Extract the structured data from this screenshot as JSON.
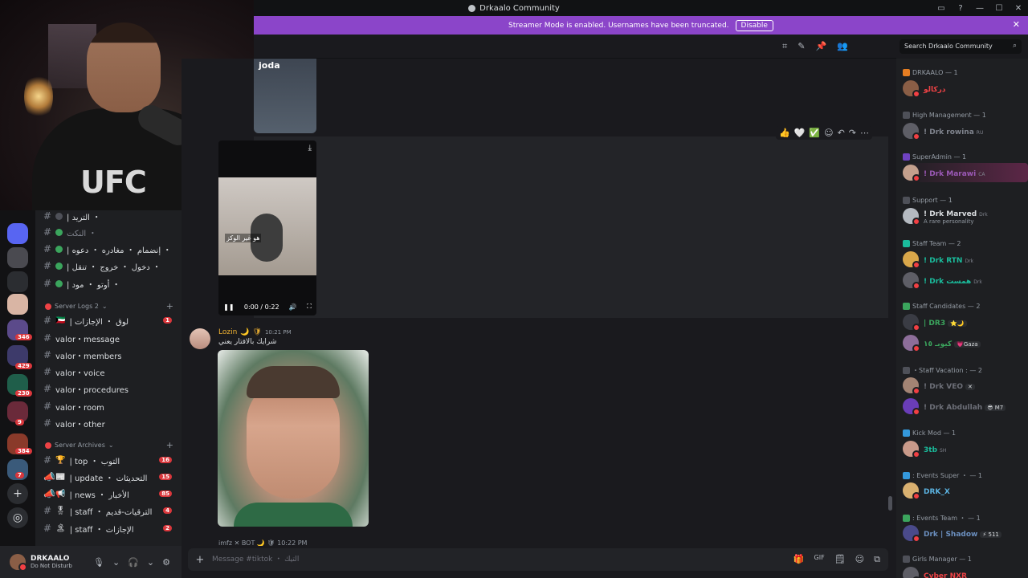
{
  "window": {
    "title": "Drkaalo Community",
    "controls": [
      "▭",
      "?",
      "—",
      "☐",
      "✕"
    ]
  },
  "streamer": {
    "message": "Streamer Mode is enabled. Usernames have been truncated.",
    "disable_label": "Disable",
    "close": "✕"
  },
  "search": {
    "placeholder": "Search Drkaalo Community",
    "icon": "⌕"
  },
  "header_icons": [
    "⌗",
    "✎",
    "📌",
    "👥"
  ],
  "webcam": {
    "shirt_text": "UFC"
  },
  "servers": [
    {
      "badge": ""
    },
    {
      "badge": ""
    },
    {
      "badge": ""
    },
    {
      "badge": ""
    },
    {
      "badge": "346"
    },
    {
      "badge": "429"
    },
    {
      "badge": "230"
    },
    {
      "badge": "9"
    },
    {
      "badge": "384"
    },
    {
      "badge": "7"
    }
  ],
  "server_actions": {
    "add": "+",
    "discover": "◎"
  },
  "channels_top": [
    {
      "name": "| التريد ・",
      "dot": "gray"
    },
    {
      "name": "النكت ・",
      "dot": "green",
      "muted": true
    },
    {
      "name": "| إنضمام ・ مغادره ・ دعوه ・",
      "dot": "green"
    },
    {
      "name": "| دخول ・ خروج ・ تنقل ・",
      "dot": "green"
    },
    {
      "name": "| أوتو ・ مود ・",
      "dot": "green"
    }
  ],
  "category_logs": {
    "label": "Server Logs 2",
    "plus": "+"
  },
  "channels_logs": [
    {
      "name": "| لوق ・ الإجازات",
      "icon": "🇰🇼",
      "count": "1"
    },
    {
      "name": "valor・message",
      "icon": "",
      "count": ""
    },
    {
      "name": "valor・members",
      "icon": "",
      "count": ""
    },
    {
      "name": "valor・voice",
      "icon": "",
      "count": ""
    },
    {
      "name": "valor・procedures",
      "icon": "",
      "count": ""
    },
    {
      "name": "valor・room",
      "icon": "",
      "count": ""
    },
    {
      "name": "valor・other",
      "icon": "",
      "count": ""
    }
  ],
  "category_archives": {
    "label": "Server Archives",
    "plus": "+"
  },
  "channels_archives": [
    {
      "name": "| top ・ التوب",
      "icon": "🏆",
      "count": "16"
    },
    {
      "name": "| update ・ التحديثات",
      "icon": "📰",
      "count": "15"
    },
    {
      "name": "| news ・ الأخبار",
      "icon": "📢",
      "count": "85"
    },
    {
      "name": "| staff ・ الترقيات-قديم",
      "icon": "🎖",
      "count": "4"
    },
    {
      "name": "| staff ・ الإجازات",
      "icon": "🏝",
      "count": "2"
    }
  ],
  "user": {
    "name": "DRKAALO",
    "status": "Do Not Disturb",
    "controls": [
      "🎙",
      "⌄",
      "🎧",
      "⌄",
      "⚙"
    ]
  },
  "chat": {
    "media_label": "joda",
    "actions": [
      "👍",
      "🤍",
      "✅",
      "☺",
      "↶",
      "↷",
      "⋯"
    ],
    "video": {
      "caption": "هو غير الوكز",
      "time": "0:00 / 0:22",
      "pause": "❚❚",
      "volume": "🔊",
      "fullscreen": "⛶",
      "download": "⤓"
    },
    "message": {
      "author": "Lozin",
      "time": "10:21 PM",
      "badges": [
        "🌙",
        "🛡"
      ],
      "text": "شرايك بالافتار يعني"
    },
    "next_author": "imfz  ✕ BOT  🌙 🛡  10:22 PM"
  },
  "composer": {
    "placeholder": "Message #tiktok ・ التيك",
    "plus": "+",
    "tools": [
      "🎁",
      "GIF",
      "🗒",
      "☺",
      "⧉"
    ]
  },
  "member_roles": [
    {
      "label": "DRKAALO — 1",
      "color": "#e67e22"
    },
    {
      "label": "High Management — 1",
      "color": "#4e5058"
    },
    {
      "label": "SuperAdmin — 1",
      "color": "#6f42c1"
    },
    {
      "label": "Support — 1",
      "color": "#4e5058"
    },
    {
      "label": "Staff Team — 2",
      "color": "#1abc9c"
    },
    {
      "label": "Staff Candidates — 2",
      "color": "#3ba55d"
    },
    {
      "label": "・Staff Vacation : — 2",
      "color": "#4e5058"
    },
    {
      "label": "Kick Mod — 1",
      "color": "#3498db"
    },
    {
      "label": ": Events Super ・ — 1",
      "color": "#3498db"
    },
    {
      "label": ": Events Team ・ — 1",
      "color": "#3ba55d"
    },
    {
      "label": "Girls Manager — 1",
      "color": "#4e5058"
    }
  ],
  "members": [
    {
      "name": "دركالو",
      "sub": "",
      "tag": "",
      "chip": "",
      "color": "#ed4245",
      "avatar": "#8a5e46"
    },
    {
      "name": "! Drk rowina",
      "sub": "",
      "tag": "RU",
      "chip": "",
      "color": "#80848e",
      "avatar": "#5e5e66"
    },
    {
      "name": "! Drk Marawi",
      "sub": "",
      "tag": "CA",
      "chip": "",
      "color": "#9b59b6",
      "avatar": "#c4a08d"
    },
    {
      "name": "! Drk Marved",
      "sub": "A rare personality",
      "tag": "Drk",
      "chip": "",
      "color": "#dbdee1",
      "avatar": "#b5bac1"
    },
    {
      "name": "! Drk RTN",
      "sub": "",
      "tag": "Drk",
      "chip": "",
      "color": "#1abc9c",
      "avatar": "#d9a74a"
    },
    {
      "name": "! Drk همست",
      "sub": "",
      "tag": "Drk",
      "chip": "",
      "color": "#1abc9c",
      "avatar": "#5e5e66"
    },
    {
      "name": "| DR3",
      "sub": "",
      "tag": "",
      "chip": "⭐🌙",
      "color": "#3ba55d",
      "avatar": "#3a3c44"
    },
    {
      "name": "كيوبـ ١٥",
      "sub": "",
      "tag": "",
      "chip": "💗Gaza",
      "color": "#3ba55d",
      "avatar": "#8d6e9a"
    },
    {
      "name": "! Drk VEO",
      "sub": "",
      "tag": "",
      "chip": "✕",
      "color": "#6d6f78",
      "avatar": "#a38474"
    },
    {
      "name": "! Drk Abdullah",
      "sub": "",
      "tag": "",
      "chip": "😎 M7",
      "color": "#6d6f78",
      "avatar": "#6a3db8"
    },
    {
      "name": "3tb",
      "sub": "",
      "tag": "SH",
      "chip": "",
      "color": "#1abc9c",
      "avatar": "#c99a8a"
    },
    {
      "name": "DRK_X",
      "sub": "",
      "tag": "",
      "chip": "",
      "color": "#5bb2e0",
      "avatar": "#d9b070"
    },
    {
      "name": "Drk | Shadow",
      "sub": "",
      "tag": "",
      "chip": "⚡ 511",
      "color": "#6b8fbf",
      "avatar": "#4a4a8a"
    },
    {
      "name": "Cyber NXR",
      "sub": "",
      "tag": "",
      "chip": "",
      "color": "#ed4245",
      "avatar": "#5e5e66"
    }
  ]
}
